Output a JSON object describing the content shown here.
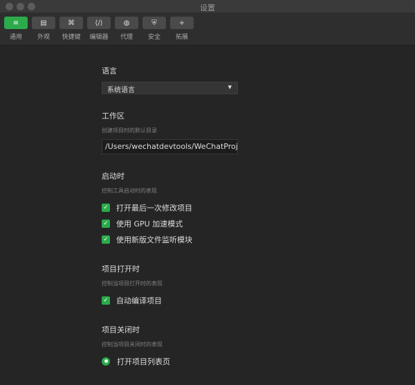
{
  "window": {
    "title": "设置"
  },
  "toolbar": [
    {
      "label": "通用",
      "icon": "≡"
    },
    {
      "label": "外观",
      "icon": "▤"
    },
    {
      "label": "快捷键",
      "icon": "⌘"
    },
    {
      "label": "编辑器",
      "icon": "⟨/⟩"
    },
    {
      "label": "代理",
      "icon": "◍"
    },
    {
      "label": "安全",
      "icon": "⛨"
    },
    {
      "label": "拓展",
      "icon": "+"
    }
  ],
  "language": {
    "heading": "语言",
    "value": "系统语言"
  },
  "workspace": {
    "heading": "工作区",
    "sub": "创建项目时的默认目录",
    "value": "/Users/wechatdevtools/WeChatProje"
  },
  "startup": {
    "heading": "启动时",
    "sub": "控制工具启动时的表现",
    "options": [
      "打开最后一次修改项目",
      "使用 GPU 加速模式",
      "使用新版文件监听模块"
    ]
  },
  "project_open": {
    "heading": "项目打开时",
    "sub": "控制当项目打开时的表现",
    "options": [
      "自动编译项目"
    ]
  },
  "project_close": {
    "heading": "项目关闭时",
    "sub": "控制当项目关闭时的表现",
    "options": [
      "打开项目列表页"
    ]
  },
  "colors": {
    "accent": "#2bab4b"
  }
}
